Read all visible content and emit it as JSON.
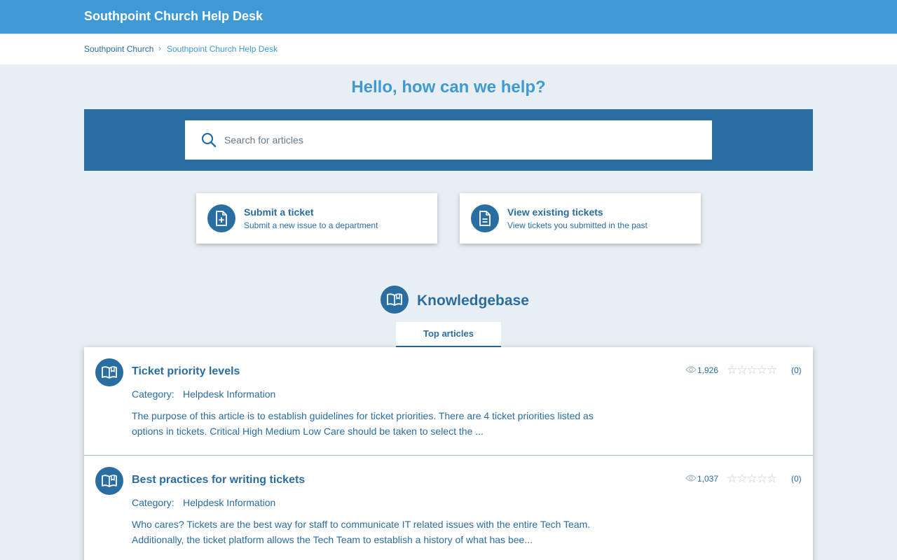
{
  "header": {
    "title": "Southpoint Church Help Desk"
  },
  "breadcrumb": {
    "items": [
      "Southpoint Church",
      "Southpoint Church Help Desk"
    ],
    "separator": "›"
  },
  "hero": {
    "greeting": "Hello, how can we help?"
  },
  "search": {
    "placeholder": "Search for articles",
    "value": "",
    "icon": "search-icon"
  },
  "actions": [
    {
      "title": "Submit a ticket",
      "subtitle": "Submit a new issue to a department",
      "icon": "file-plus-icon"
    },
    {
      "title": "View existing tickets",
      "subtitle": "View tickets you submitted in the past",
      "icon": "file-text-icon"
    }
  ],
  "knowledgebase": {
    "title": "Knowledgebase",
    "icon": "open-book-icon",
    "tabs": [
      {
        "label": "Top articles",
        "active": true
      }
    ],
    "articles": [
      {
        "title": "Ticket priority levels",
        "category_label": "Category:",
        "category": "Helpdesk Information",
        "excerpt": "The purpose of this article is to establish guidelines for ticket priorities. There are 4 ticket priorities listed as options in tickets. Critical High Medium Low Care should be taken to select the ...",
        "views": "1,926",
        "rating": 0,
        "rating_max": 5,
        "rating_count": "(0)"
      },
      {
        "title": "Best practices for writing tickets",
        "category_label": "Category:",
        "category": "Helpdesk Information",
        "excerpt": "Who cares? Tickets are the best way for staff to communicate IT related issues with the entire Tech Team. Additionally, the ticket platform allows the Tech Team to establish a history of what has bee...",
        "views": "1,037",
        "rating": 0,
        "rating_max": 5,
        "rating_count": "(0)"
      }
    ]
  },
  "colors": {
    "header_bg": "#3f99d5",
    "accent": "#2a6da0",
    "page_bg": "#e8eff4",
    "star_empty": "#c5ccd2"
  }
}
